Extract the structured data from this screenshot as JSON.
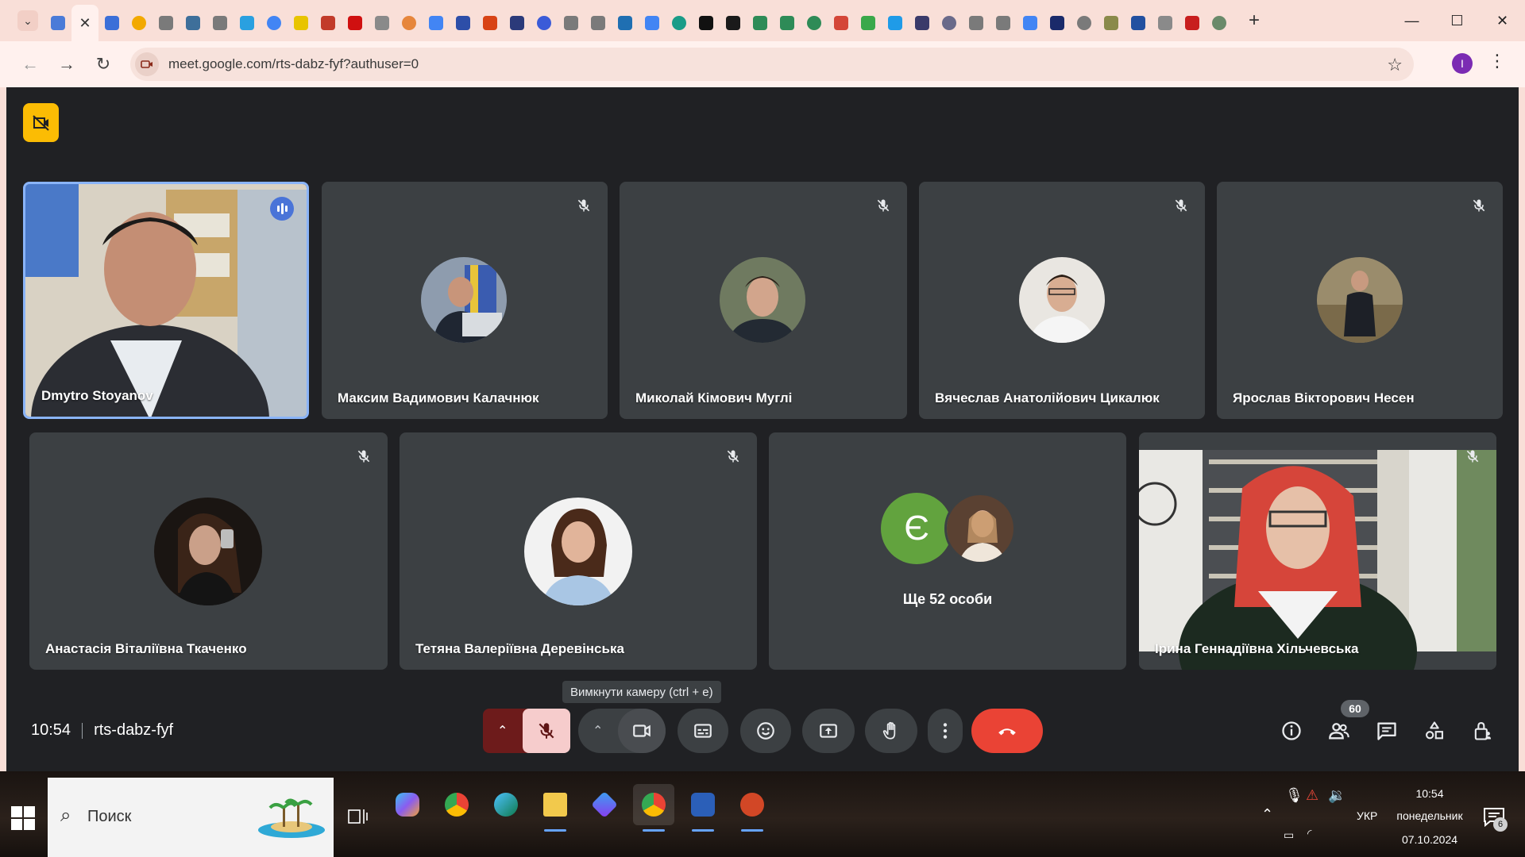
{
  "browser": {
    "url": "meet.google.com/rts-dabz-fyf?authuser=0",
    "profile_initial": "I",
    "tab_favicons": [
      "#4a7bd8",
      "active",
      "#3b6fd8",
      "#f2a900",
      "#7a7a7a",
      "#3e6f9a",
      "#7a7a7a",
      "#2aa0e0",
      "#4285f4",
      "#e8c400",
      "#c23b2a",
      "#d01010",
      "#8a8a8a",
      "#e6863c",
      "#4285f4",
      "#2d4ea8",
      "#d84315",
      "#2b3a7a",
      "#3b5bd8",
      "#7a7a7a",
      "#7a7a7a",
      "#1f6fb2",
      "#4285f4",
      "#1a9c88",
      "#111111",
      "#1a1a1a",
      "#2e8b57",
      "#2e8b57",
      "#2e8b57",
      "#d44638",
      "#3aa84a",
      "#1f9be8",
      "#3a3a6a",
      "#6a6a8a",
      "#7a7a7a",
      "#7a7a7a",
      "#4285f4",
      "#1a2a6a",
      "#7a7a7a",
      "#8a8a4a",
      "#2250a0",
      "#8a8a8a",
      "#c81e1e",
      "#6a8a6a"
    ]
  },
  "meet": {
    "meeting_code": "rts-dabz-fyf",
    "time": "10:54",
    "tooltip": "Вимкнути камеру (ctrl + e)",
    "participant_count": "60",
    "others_label": "Ще 52 особи",
    "others_initial": "Є",
    "participants": [
      {
        "name": "Dmytro Stoyanov",
        "speaking": true
      },
      {
        "name": "Максим Вадимович Калачнюк"
      },
      {
        "name": "Миколай Кімович Муглі"
      },
      {
        "name": "Вячеслав Анатолійович Цикалюк"
      },
      {
        "name": "Ярослав Вікторович Несен"
      },
      {
        "name": "Анастасія Віталіївна Ткаченко"
      },
      {
        "name": "Тетяна Валеріївна Деревінська"
      },
      {
        "name": "Ірина Геннадіївна Хільчевська"
      }
    ],
    "colors": {
      "accent": "#fbbc04",
      "end_call": "#ea4335",
      "mic_off_bg": "#f6cccc",
      "speaking": "#4a74d8"
    }
  },
  "taskbar": {
    "search_label": "Поиск",
    "language": "УКР",
    "time": "10:54",
    "day": "понедельник",
    "date": "07.10.2024",
    "notifications": "6"
  }
}
